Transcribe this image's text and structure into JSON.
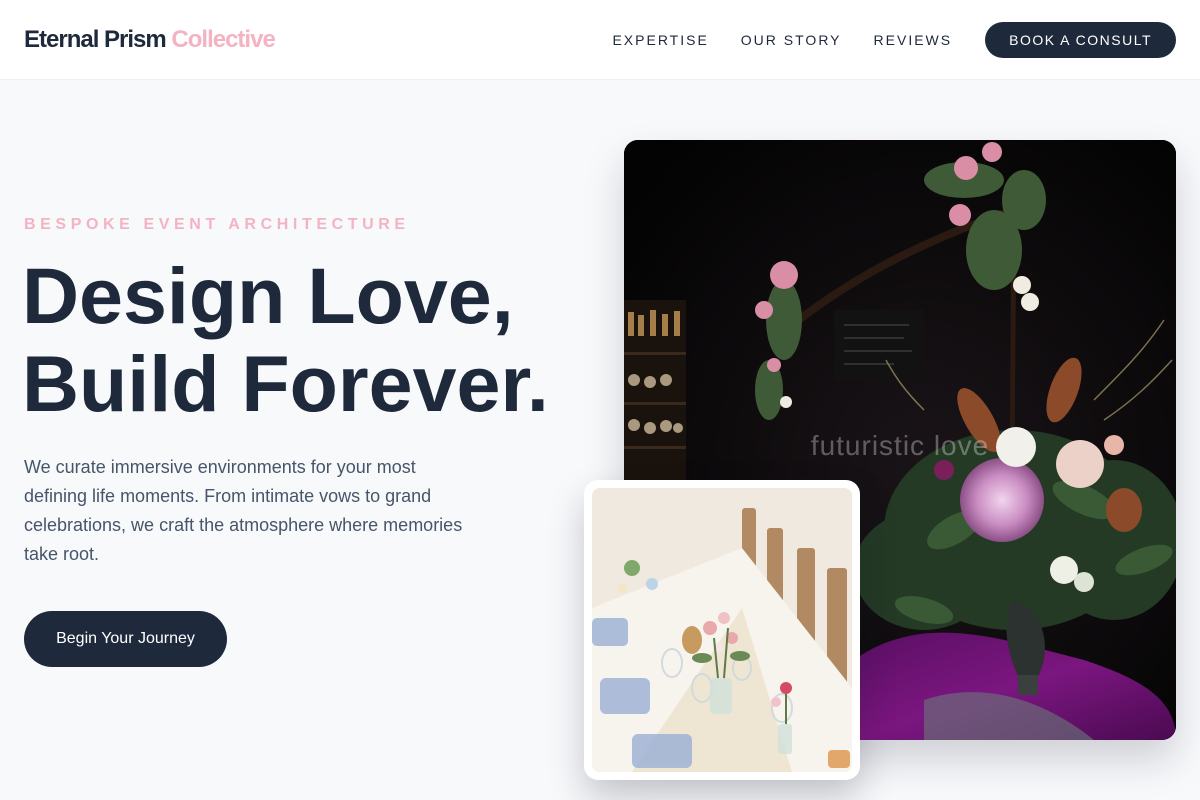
{
  "brand": {
    "name_primary": "Eternal Prism",
    "name_accent": "Collective",
    "accent_color": "#f4b3c2",
    "dark_color": "#1e293b"
  },
  "nav": {
    "items": [
      {
        "label": "EXPERTISE"
      },
      {
        "label": "OUR STORY"
      },
      {
        "label": "REVIEWS"
      }
    ],
    "cta_label": "BOOK A CONSULT"
  },
  "hero": {
    "eyebrow": "BESPOKE EVENT ARCHITECTURE",
    "headline_line1": "Design Love,",
    "headline_line2": "Build Forever.",
    "lede": "We curate immersive environments for your most defining life moments. From intimate vows to grand celebrations, we craft the atmosphere where memories take root.",
    "button_label": "Begin Your Journey"
  },
  "images": {
    "main_watermark": "futuristic love"
  }
}
